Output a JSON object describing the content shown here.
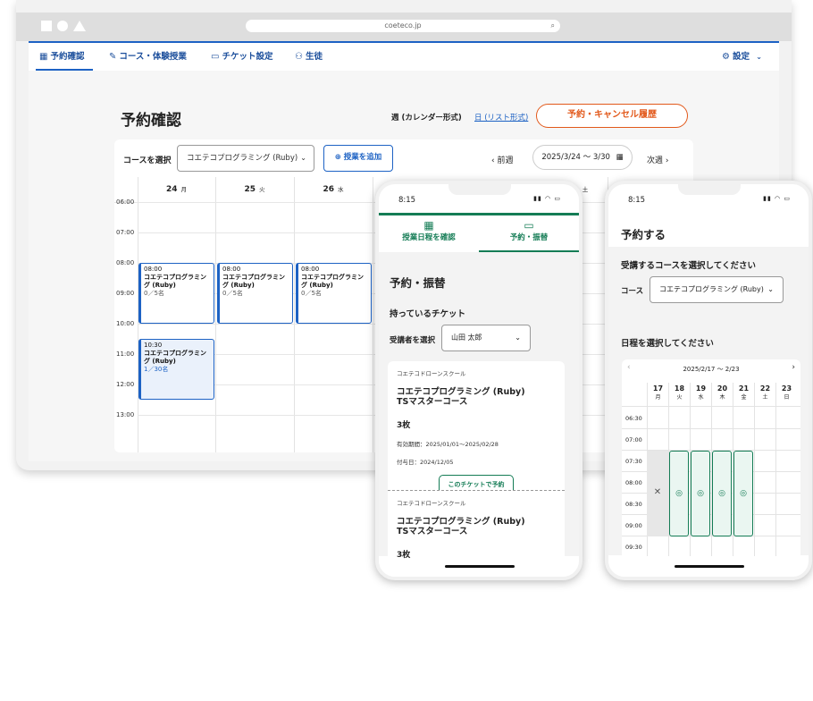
{
  "desktop": {
    "url": "coeteco.jp",
    "nav": [
      {
        "label": "予約確認",
        "icon": "calendar-icon"
      },
      {
        "label": "コース・体験授業",
        "icon": "pencil-icon"
      },
      {
        "label": "チケット設定",
        "icon": "ticket-icon"
      },
      {
        "label": "生徒",
        "icon": "users-icon"
      }
    ],
    "settings_label": "設定",
    "page_title": "予約確認",
    "view_week": "週 (カレンダー形式)",
    "view_list": "日 (リスト形式)",
    "history_button": "予約・キャンセル履歴",
    "course_label": "コースを選択",
    "course_value": "コエテコプログラミング (Ruby)",
    "add_class": "授業を追加",
    "prev": "前週",
    "week_range": "2025/3/24 〜 3/30",
    "next": "次週",
    "days": [
      {
        "num": "24",
        "dow": "月"
      },
      {
        "num": "25",
        "dow": "火"
      },
      {
        "num": "26",
        "dow": "水"
      },
      {
        "num": "",
        "dow": "土"
      }
    ],
    "times": [
      "06:00",
      "07:00",
      "08:00",
      "09:00",
      "10:00",
      "11:00",
      "12:00",
      "13:00"
    ],
    "events": [
      {
        "time": "08:00",
        "name": "コエテコプログラミング (Ruby)",
        "cap": "0／5名"
      },
      {
        "time": "08:00",
        "name": "コエテコプログラミング (Ruby)",
        "cap": "0／5名"
      },
      {
        "time": "08:00",
        "name": "コエテコプログラミング (Ruby)",
        "cap": "0／5名"
      },
      {
        "time": "10:30",
        "name": "コエテコプログラミング (Ruby)",
        "cap": "1／30名"
      }
    ]
  },
  "phone1": {
    "time": "8:15",
    "tabs": [
      "授業日程を確認",
      "予約・振替"
    ],
    "title": "予約・振替",
    "subtitle": "持っているチケット",
    "learner_label": "受講者を選択",
    "learner_value": "山田 太郎",
    "tickets": [
      {
        "school": "コエテコドローンスクール",
        "course1": "コエテコプログラミング (Ruby)",
        "course2": "TSマスターコース",
        "count": "3枚",
        "period": "有効期間：2025/01/01〜2025/02/28",
        "granted": "付与日：2024/12/05",
        "button": "このチケットで予約"
      },
      {
        "school": "コエテコドローンスクール",
        "course1": "コエテコプログラミング (Ruby)",
        "course2": "TSマスターコース",
        "count": "3枚"
      }
    ]
  },
  "phone2": {
    "time": "8:15",
    "title": "予約する",
    "sub1": "受講するコースを選択してください",
    "course_label": "コース",
    "course_value": "コエテコプログラミング (Ruby)",
    "sub2": "日程を選択してください",
    "range": "2025/2/17 〜 2/23",
    "days": [
      {
        "num": "17",
        "dow": "月"
      },
      {
        "num": "18",
        "dow": "火"
      },
      {
        "num": "19",
        "dow": "水"
      },
      {
        "num": "20",
        "dow": "木"
      },
      {
        "num": "21",
        "dow": "金"
      },
      {
        "num": "22",
        "dow": "土"
      },
      {
        "num": "23",
        "dow": "日"
      }
    ],
    "times": [
      "06:30",
      "07:00",
      "07:30",
      "08:00",
      "08:30",
      "09:00",
      "09:30"
    ],
    "unavailable": "✕",
    "available": "◎"
  }
}
